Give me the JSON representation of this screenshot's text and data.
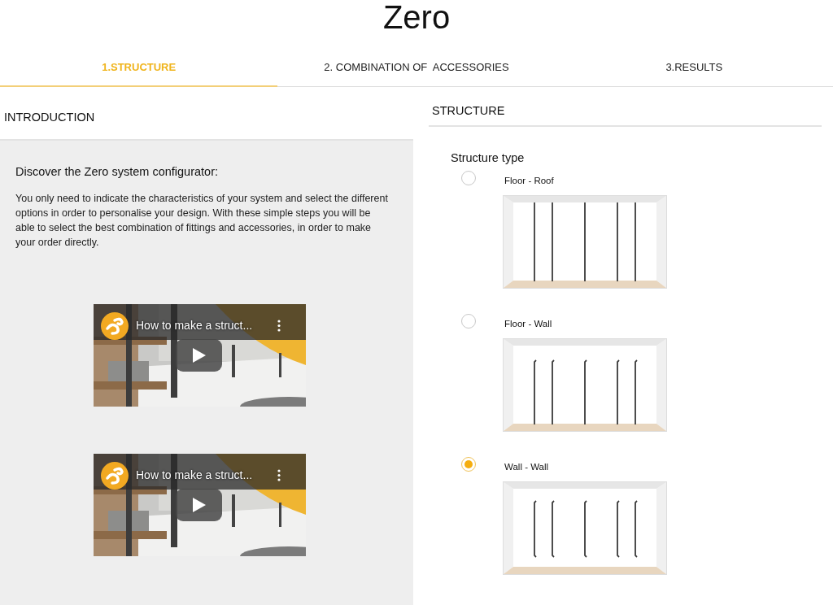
{
  "page": {
    "title": "Zero"
  },
  "tabs": [
    {
      "label": "1.STRUCTURE",
      "selected": true
    },
    {
      "label": "2. COMBINATION OF  ACCESSORIES",
      "selected": false
    },
    {
      "label": "3.RESULTS",
      "selected": false
    }
  ],
  "introduction": {
    "header": "INTRODUCTION",
    "heading": "Discover the Zero system configurator:",
    "text": "You only need to indicate the characteristics of your system and select the different options in order to personalise your design. With these simple steps you will be able to select the best combination of fittings and accessories, in order to make your order directly.",
    "videos": [
      {
        "title": "How to make a struct..."
      },
      {
        "title": "How to make a struct..."
      }
    ]
  },
  "structure": {
    "header": "STRUCTURE",
    "label": "Structure type",
    "options": [
      {
        "label": "Floor - Roof",
        "kind": "floor-roof",
        "selected": false
      },
      {
        "label": "Floor - Wall",
        "kind": "floor-wall",
        "selected": false
      },
      {
        "label": "Wall - Wall",
        "kind": "wall-wall",
        "selected": true
      }
    ]
  }
}
